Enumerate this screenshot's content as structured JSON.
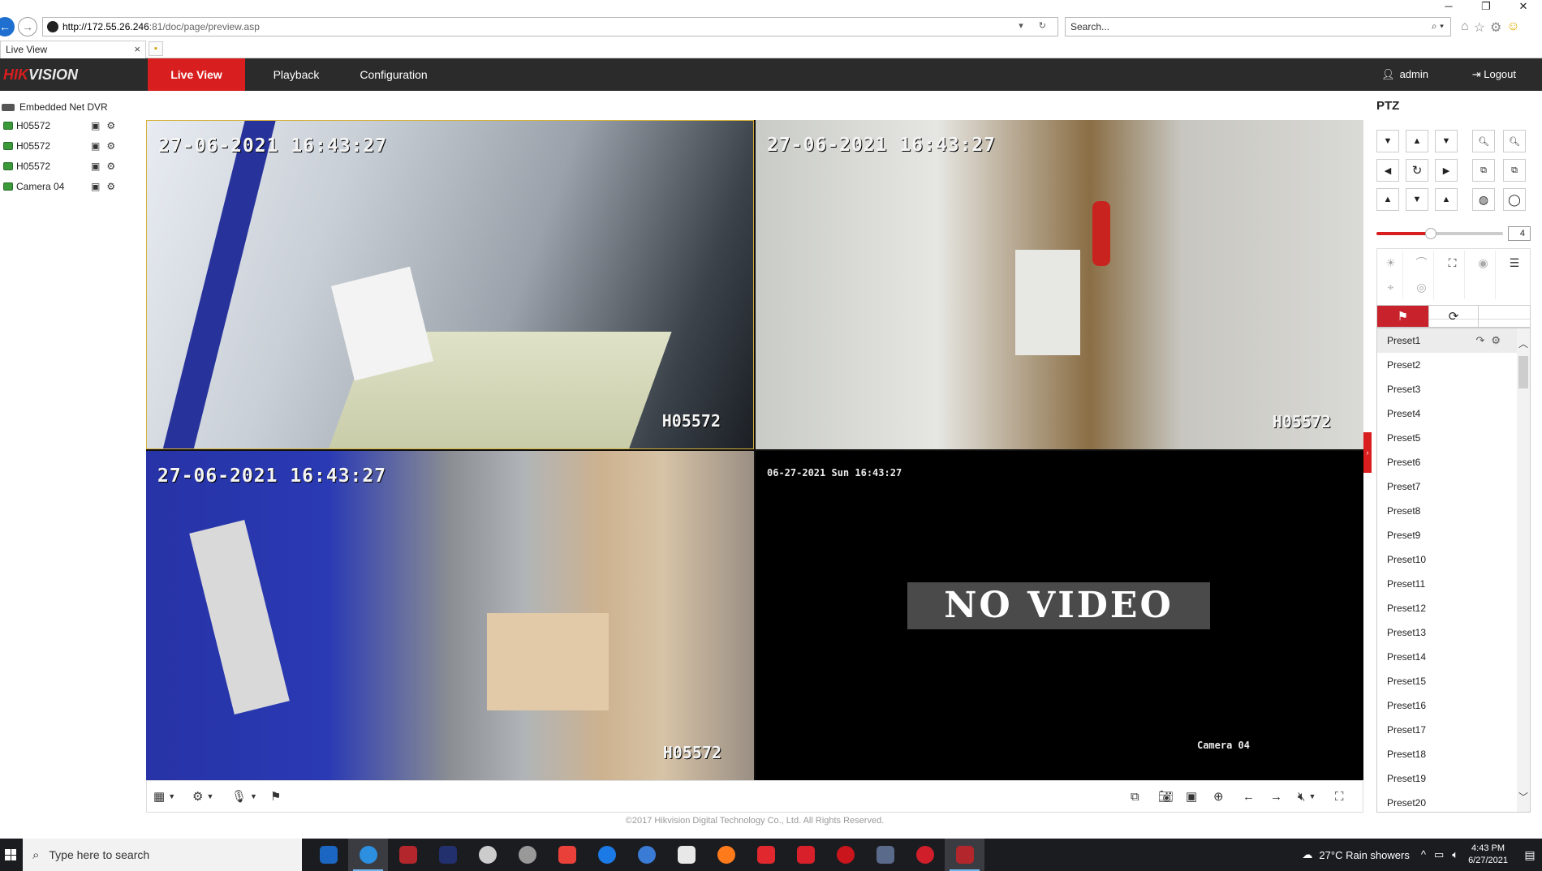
{
  "browser": {
    "address_host": "http://172.55.26.246",
    "address_path": ":81/doc/page/preview.asp",
    "search_placeholder": "Search...",
    "tab_title": "Live View",
    "tab_close": "×"
  },
  "header": {
    "logo_red": "HIK",
    "logo_rest": "VISION",
    "nav": [
      {
        "label": "Live View",
        "active": true
      },
      {
        "label": "Playback"
      },
      {
        "label": "Configuration"
      }
    ],
    "user": "admin",
    "logout": "Logout"
  },
  "device_tree": {
    "root": "Embedded Net DVR",
    "cameras": [
      {
        "name": "H05572"
      },
      {
        "name": "H05572"
      },
      {
        "name": "H05572"
      },
      {
        "name": "Camera 04"
      }
    ]
  },
  "video": {
    "panes": [
      {
        "time": "27-06-2021 16:43:27",
        "name": "H05572"
      },
      {
        "time": "27-06-2021 16:43:27",
        "name": "H05572"
      },
      {
        "time": "27-06-2021 16:43:27",
        "name": "H05572"
      },
      {
        "time": "06-27-2021 Sun 16:43:27",
        "name": "Camera 04",
        "status": "NO VIDEO"
      }
    ]
  },
  "footer": "©2017 Hikvision Digital Technology Co., Ltd. All Rights Reserved.",
  "ptz": {
    "title": "PTZ",
    "speed": "4",
    "speed_level": 0.43,
    "presets": [
      "Preset1",
      "Preset2",
      "Preset3",
      "Preset4",
      "Preset5",
      "Preset6",
      "Preset7",
      "Preset8",
      "Preset9",
      "Preset10",
      "Preset11",
      "Preset12",
      "Preset13",
      "Preset14",
      "Preset15",
      "Preset16",
      "Preset17",
      "Preset18",
      "Preset19",
      "Preset20"
    ]
  },
  "taskbar": {
    "search_placeholder": "Type here to search",
    "weather": "27°C  Rain showers",
    "time": "4:43 PM",
    "date": "6/27/2021"
  },
  "colors": {
    "accent": "#d81e1e",
    "header_bg": "#2b2b2b",
    "taskbar_bg": "#1b1c20"
  }
}
